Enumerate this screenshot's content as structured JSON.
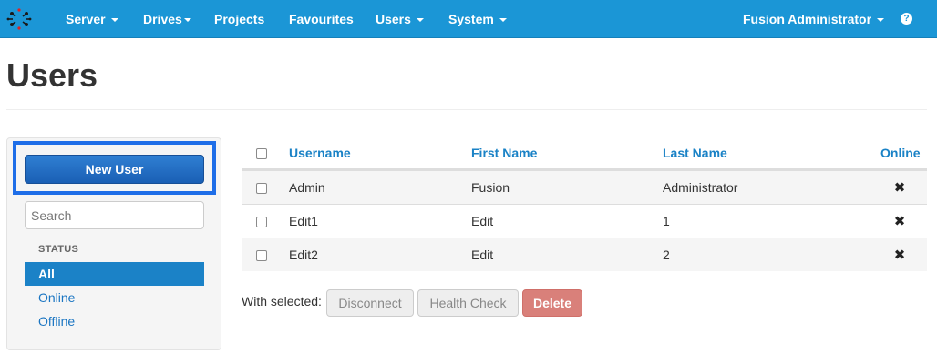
{
  "navbar": {
    "items": [
      {
        "label": "Server",
        "dropdown": true
      },
      {
        "label": "Drives",
        "dropdown": true
      },
      {
        "label": "Projects",
        "dropdown": false
      },
      {
        "label": "Favourites",
        "dropdown": false
      },
      {
        "label": "Users",
        "dropdown": true
      },
      {
        "label": "System",
        "dropdown": true
      }
    ],
    "user_menu": "Fusion Administrator",
    "help_icon": "question-circle-icon",
    "background": "#1b96d6"
  },
  "page": {
    "title": "Users"
  },
  "sidebar": {
    "new_user_label": "New User",
    "search_placeholder": "Search",
    "status_header": "STATUS",
    "filters": [
      "All",
      "Online",
      "Offline"
    ],
    "active_filter": "All"
  },
  "table": {
    "headers": [
      "Username",
      "First Name",
      "Last Name",
      "Online"
    ],
    "rows": [
      {
        "username": "Admin",
        "first_name": "Fusion",
        "last_name": "Administrator",
        "online_icon": "cross-icon"
      },
      {
        "username": "Edit1",
        "first_name": "Edit",
        "last_name": "1",
        "online_icon": "cross-icon"
      },
      {
        "username": "Edit2",
        "first_name": "Edit",
        "last_name": "2",
        "online_icon": "cross-icon"
      }
    ]
  },
  "bulk": {
    "label": "With selected:",
    "disconnect_label": "Disconnect",
    "health_check_label": "Health Check",
    "delete_label": "Delete"
  },
  "colors": {
    "accent": "#1b96d6",
    "link": "#1a82c6",
    "primary_button": "#1f6cc4",
    "danger": "#d9807a",
    "highlight": "#1e6ee8"
  }
}
